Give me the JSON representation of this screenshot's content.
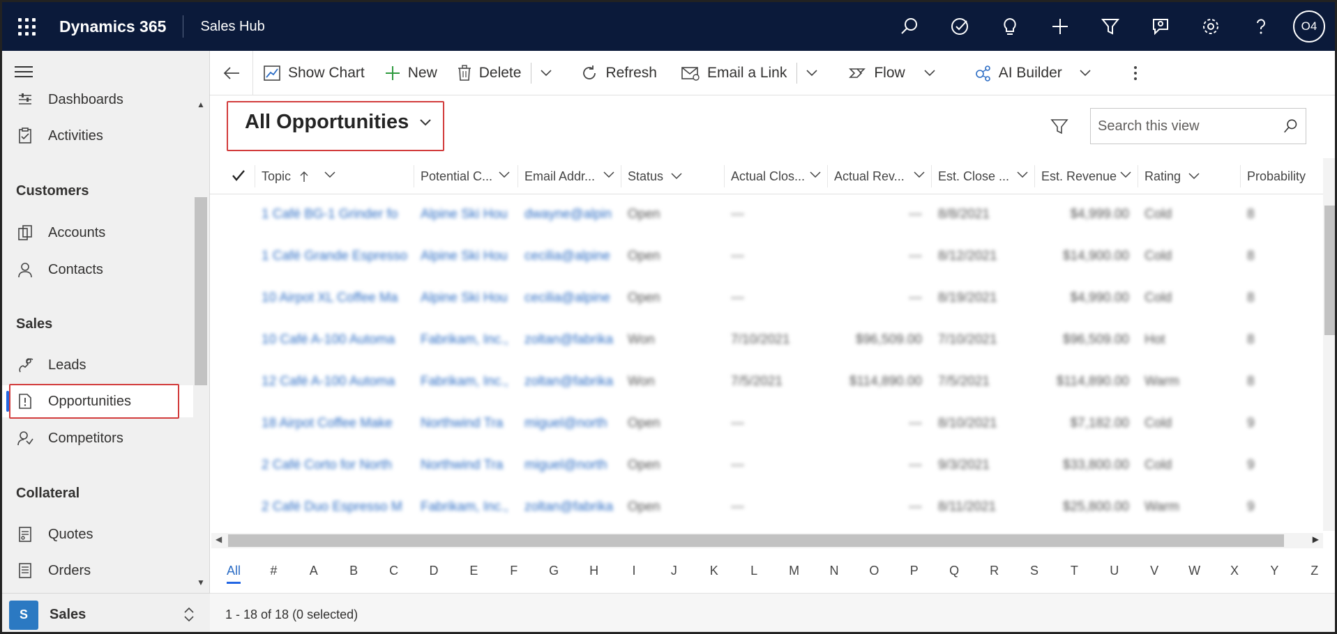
{
  "topbar": {
    "brand": "Dynamics 365",
    "app": "Sales Hub",
    "icons": [
      "search-icon",
      "task-icon",
      "lightbulb-icon",
      "plus-icon",
      "filter-icon",
      "assist-icon",
      "gear-icon",
      "help-icon"
    ],
    "user_initials": "O4",
    "background": "#0b1a3a"
  },
  "sidebar": {
    "items_top": [
      {
        "label": "Dashboards",
        "icon": "dashboard-icon"
      },
      {
        "label": "Activities",
        "icon": "clipboard-icon"
      }
    ],
    "groups": [
      {
        "title": "Customers",
        "items": [
          {
            "label": "Accounts",
            "icon": "accounts-icon"
          },
          {
            "label": "Contacts",
            "icon": "person-icon"
          }
        ]
      },
      {
        "title": "Sales",
        "items": [
          {
            "label": "Leads",
            "icon": "leads-icon"
          },
          {
            "label": "Opportunities",
            "icon": "opportunity-icon",
            "selected": true
          },
          {
            "label": "Competitors",
            "icon": "competitor-icon"
          }
        ]
      },
      {
        "title": "Collateral",
        "items": [
          {
            "label": "Quotes",
            "icon": "quotes-icon"
          },
          {
            "label": "Orders",
            "icon": "orders-icon"
          }
        ]
      }
    ],
    "area": {
      "badge": "S",
      "label": "Sales",
      "badge_color": "#2b79c2"
    }
  },
  "commands": {
    "show_chart": "Show Chart",
    "new": "New",
    "delete": "Delete",
    "refresh": "Refresh",
    "email_link": "Email a Link",
    "flow": "Flow",
    "ai_builder": "AI Builder"
  },
  "view": {
    "title": "All Opportunities",
    "search_placeholder": "Search this view"
  },
  "grid": {
    "columns": [
      "Topic",
      "Potential C...",
      "Email Addr...",
      "Status",
      "Actual Clos...",
      "Actual Rev...",
      "Est. Close ...",
      "Est. Revenue",
      "Rating",
      "Probability"
    ],
    "rows": [
      [
        "1 Café BG-1 Grinder fo",
        "Alpine Ski Hou",
        "dwayne@alpin",
        "Open",
        "---",
        "---",
        "8/8/2021",
        "$4,999.00",
        "Cold",
        "8"
      ],
      [
        "1 Café Grande Espresso",
        "Alpine Ski Hou",
        "cecilia@alpine",
        "Open",
        "---",
        "---",
        "8/12/2021",
        "$14,900.00",
        "Cold",
        "8"
      ],
      [
        "10 Airpot XL Coffee Ma",
        "Alpine Ski Hou",
        "cecilia@alpine",
        "Open",
        "---",
        "---",
        "8/19/2021",
        "$4,990.00",
        "Cold",
        "8"
      ],
      [
        "10 Café A-100 Automa",
        "Fabrikam, Inc.,",
        "zoltan@fabrika",
        "Won",
        "7/10/2021",
        "$96,509.00",
        "7/10/2021",
        "$96,509.00",
        "Hot",
        "8"
      ],
      [
        "12 Café A-100 Automa",
        "Fabrikam, Inc.,",
        "zoltan@fabrika",
        "Won",
        "7/5/2021",
        "$114,890.00",
        "7/5/2021",
        "$114,890.00",
        "Warm",
        "8"
      ],
      [
        "18 Airpot Coffee Make",
        "Northwind Tra",
        "miguel@north",
        "Open",
        "---",
        "---",
        "8/10/2021",
        "$7,182.00",
        "Cold",
        "9"
      ],
      [
        "2 Café Corto for North",
        "Northwind Tra",
        "miguel@north",
        "Open",
        "---",
        "---",
        "9/3/2021",
        "$33,800.00",
        "Cold",
        "9"
      ],
      [
        "2 Café Duo Espresso M",
        "Fabrikam, Inc.,",
        "zoltan@fabrika",
        "Open",
        "---",
        "---",
        "8/11/2021",
        "$25,800.00",
        "Warm",
        "9"
      ]
    ]
  },
  "jumpbar": [
    "All",
    "#",
    "A",
    "B",
    "C",
    "D",
    "E",
    "F",
    "G",
    "H",
    "I",
    "J",
    "K",
    "L",
    "M",
    "N",
    "O",
    "P",
    "Q",
    "R",
    "S",
    "T",
    "U",
    "V",
    "W",
    "X",
    "Y",
    "Z"
  ],
  "status": "1 - 18 of 18 (0 selected)",
  "colors": {
    "accent": "#2266e3",
    "highlight": "#d23b3b",
    "link": "#2b6cc4"
  }
}
